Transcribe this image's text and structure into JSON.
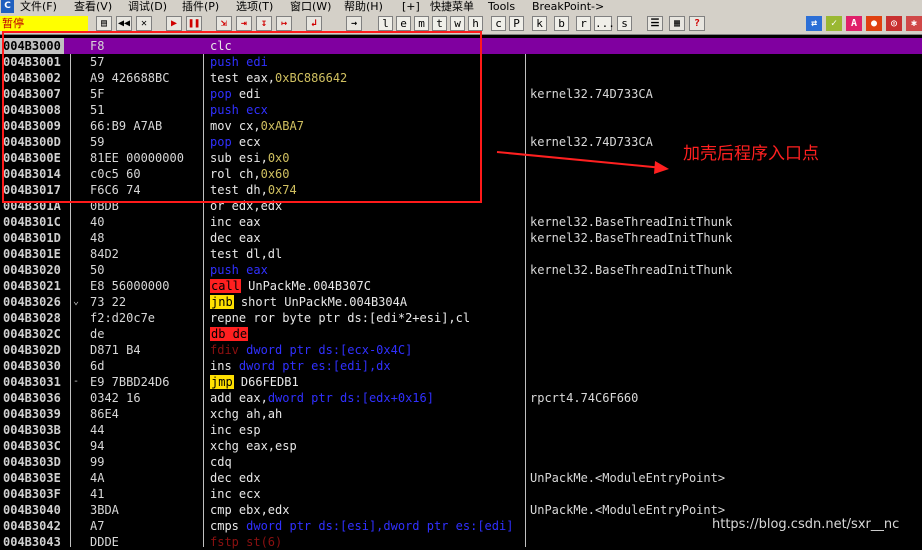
{
  "menu": {
    "logo": "C",
    "items": [
      "文件(F)",
      "查看(V)",
      "调试(D)",
      "插件(P)",
      "选项(T)",
      "窗口(W)",
      "帮助(H)",
      "[+]",
      "快捷菜单",
      "Tools",
      "BreakPoint->"
    ]
  },
  "status": {
    "text": "暂停"
  },
  "toolbar": {
    "letters": [
      "l",
      "e",
      "m",
      "t",
      "w",
      "h",
      "c",
      "P",
      "k",
      "b",
      "r",
      "...",
      "s"
    ]
  },
  "rows": [
    {
      "addr": "004B3000",
      "hex": "F8",
      "parts": [
        {
          "t": "clc",
          "c": "t-mn"
        }
      ],
      "cmt": ""
    },
    {
      "addr": "004B3001",
      "hex": "57",
      "parts": [
        {
          "t": "push ",
          "c": "t-blue"
        },
        {
          "t": "edi",
          "c": "t-blue"
        }
      ],
      "cmt": ""
    },
    {
      "addr": "004B3002",
      "hex": "A9 426688BC",
      "parts": [
        {
          "t": "test ",
          "c": "t-mn"
        },
        {
          "t": "eax,",
          "c": "t-reg"
        },
        {
          "t": "0xBC886642",
          "c": "t-num"
        }
      ],
      "cmt": ""
    },
    {
      "addr": "004B3007",
      "hex": "5F",
      "parts": [
        {
          "t": "pop ",
          "c": "t-blue"
        },
        {
          "t": "edi",
          "c": "t-reg"
        }
      ],
      "cmt": "kernel32.74D733CA"
    },
    {
      "addr": "004B3008",
      "hex": "51",
      "parts": [
        {
          "t": "push ",
          "c": "t-blue"
        },
        {
          "t": "ecx",
          "c": "t-blue"
        }
      ],
      "cmt": ""
    },
    {
      "addr": "004B3009",
      "hex": "66:B9 A7AB",
      "parts": [
        {
          "t": "mov ",
          "c": "t-mn"
        },
        {
          "t": "cx,",
          "c": "t-reg"
        },
        {
          "t": "0xABA7",
          "c": "t-num"
        }
      ],
      "cmt": ""
    },
    {
      "addr": "004B300D",
      "hex": "59",
      "parts": [
        {
          "t": "pop ",
          "c": "t-blue"
        },
        {
          "t": "ecx",
          "c": "t-reg"
        }
      ],
      "cmt": "kernel32.74D733CA"
    },
    {
      "addr": "004B300E",
      "hex": "81EE 00000000",
      "parts": [
        {
          "t": "sub ",
          "c": "t-mn"
        },
        {
          "t": "esi,",
          "c": "t-reg"
        },
        {
          "t": "0x0",
          "c": "t-num"
        }
      ],
      "cmt": ""
    },
    {
      "addr": "004B3014",
      "hex": "c0c5 60",
      "parts": [
        {
          "t": "rol ",
          "c": "t-mn"
        },
        {
          "t": "ch,",
          "c": "t-reg"
        },
        {
          "t": "0x60",
          "c": "t-num"
        }
      ],
      "cmt": ""
    },
    {
      "addr": "004B3017",
      "hex": "F6C6 74",
      "parts": [
        {
          "t": "test ",
          "c": "t-mn"
        },
        {
          "t": "dh,",
          "c": "t-reg"
        },
        {
          "t": "0x74",
          "c": "t-num"
        }
      ],
      "cmt": ""
    },
    {
      "addr": "004B301A",
      "hex": "0BDB",
      "parts": [
        {
          "t": "or edx,edx",
          "c": "t-mn"
        }
      ],
      "cmt": ""
    },
    {
      "addr": "004B301C",
      "hex": "40",
      "parts": [
        {
          "t": "inc ",
          "c": "t-mn"
        },
        {
          "t": "eax",
          "c": "t-reg"
        }
      ],
      "cmt": "kernel32.BaseThreadInitThunk"
    },
    {
      "addr": "004B301D",
      "hex": "48",
      "parts": [
        {
          "t": "dec ",
          "c": "t-mn"
        },
        {
          "t": "eax",
          "c": "t-reg"
        }
      ],
      "cmt": "kernel32.BaseThreadInitThunk"
    },
    {
      "addr": "004B301E",
      "hex": "84D2",
      "parts": [
        {
          "t": "test ",
          "c": "t-mn"
        },
        {
          "t": "dl,dl",
          "c": "t-reg"
        }
      ],
      "cmt": ""
    },
    {
      "addr": "004B3020",
      "hex": "50",
      "parts": [
        {
          "t": "push ",
          "c": "t-blue"
        },
        {
          "t": "eax",
          "c": "t-blue"
        }
      ],
      "cmt": "kernel32.BaseThreadInitThunk"
    },
    {
      "addr": "004B3021",
      "hex": "E8 56000000",
      "parts": [
        {
          "t": "call",
          "c": "t-call"
        },
        {
          "t": " UnPackMe.004B307C",
          "c": "t-rest"
        }
      ],
      "cmt": ""
    },
    {
      "addr": "004B3026",
      "mark": "⌄",
      "hex": "73 22",
      "parts": [
        {
          "t": "jnb",
          "c": "t-jmp"
        },
        {
          "t": " short UnPackMe.004B304A",
          "c": "t-rest"
        }
      ],
      "cmt": ""
    },
    {
      "addr": "004B3028",
      "hex": "f2:d20c7e",
      "parts": [
        {
          "t": "repne ror byte ptr ds:[edi*2+esi],cl",
          "c": "t-rest"
        }
      ],
      "cmt": ""
    },
    {
      "addr": "004B302C",
      "hex": "de",
      "parts": [
        {
          "t": "db de",
          "c": "t-call"
        }
      ],
      "cmt": ""
    },
    {
      "addr": "004B302D",
      "hex": "D871 B4",
      "parts": [
        {
          "t": "fdiv ",
          "c": "t-dark"
        },
        {
          "t": "dword ptr ds:[ecx-0x4C]",
          "c": "t-blue"
        }
      ],
      "cmt": ""
    },
    {
      "addr": "004B3030",
      "hex": "6d",
      "parts": [
        {
          "t": "ins ",
          "c": "t-mn"
        },
        {
          "t": "dword ptr es:[edi],dx",
          "c": "t-blue"
        }
      ],
      "cmt": ""
    },
    {
      "addr": "004B3031",
      "mark": "-",
      "hex": "E9 7BBD24D6",
      "parts": [
        {
          "t": "jmp",
          "c": "t-jmp"
        },
        {
          "t": " D66FEDB1",
          "c": "t-rest"
        }
      ],
      "cmt": ""
    },
    {
      "addr": "004B3036",
      "hex": "0342 16",
      "parts": [
        {
          "t": "add ",
          "c": "t-mn"
        },
        {
          "t": "eax,",
          "c": "t-reg"
        },
        {
          "t": "dword ptr ds:[edx+0x16]",
          "c": "t-blue"
        }
      ],
      "cmt": "rpcrt4.74C6F660"
    },
    {
      "addr": "004B3039",
      "hex": "86E4",
      "parts": [
        {
          "t": "xchg ",
          "c": "t-mn"
        },
        {
          "t": "ah,ah",
          "c": "t-reg"
        }
      ],
      "cmt": ""
    },
    {
      "addr": "004B303B",
      "hex": "44",
      "parts": [
        {
          "t": "inc ",
          "c": "t-mn"
        },
        {
          "t": "esp",
          "c": "t-reg"
        }
      ],
      "cmt": ""
    },
    {
      "addr": "004B303C",
      "hex": "94",
      "parts": [
        {
          "t": "xchg ",
          "c": "t-mn"
        },
        {
          "t": "eax,esp",
          "c": "t-reg"
        }
      ],
      "cmt": ""
    },
    {
      "addr": "004B303D",
      "hex": "99",
      "parts": [
        {
          "t": "cdq",
          "c": "t-mn"
        }
      ],
      "cmt": ""
    },
    {
      "addr": "004B303E",
      "hex": "4A",
      "parts": [
        {
          "t": "dec ",
          "c": "t-mn"
        },
        {
          "t": "edx",
          "c": "t-reg"
        }
      ],
      "cmt": "UnPackMe.<ModuleEntryPoint>"
    },
    {
      "addr": "004B303F",
      "hex": "41",
      "parts": [
        {
          "t": "inc ",
          "c": "t-mn"
        },
        {
          "t": "ecx",
          "c": "t-reg"
        }
      ],
      "cmt": ""
    },
    {
      "addr": "004B3040",
      "hex": "3BDA",
      "parts": [
        {
          "t": "cmp ",
          "c": "t-mn"
        },
        {
          "t": "ebx,edx",
          "c": "t-reg"
        }
      ],
      "cmt": "UnPackMe.<ModuleEntryPoint>"
    },
    {
      "addr": "004B3042",
      "hex": "A7",
      "parts": [
        {
          "t": "cmps ",
          "c": "t-mn"
        },
        {
          "t": "dword ptr ds:[esi],dword ptr es:[edi]",
          "c": "t-blue"
        }
      ],
      "cmt": ""
    },
    {
      "addr": "004B3043",
      "hex": "DDDE",
      "parts": [
        {
          "t": "fstp st(6)",
          "c": "t-dark"
        }
      ],
      "cmt": ""
    }
  ],
  "annotation": {
    "text": "加壳后程序入口点"
  },
  "watermark": {
    "text": "https://blog.csdn.net/sxr__nc"
  },
  "colors": {
    "selection": "#8000a0",
    "annotation": "#ff2020",
    "call_highlight": "#ff2020",
    "jump_highlight": "#ffe000"
  }
}
